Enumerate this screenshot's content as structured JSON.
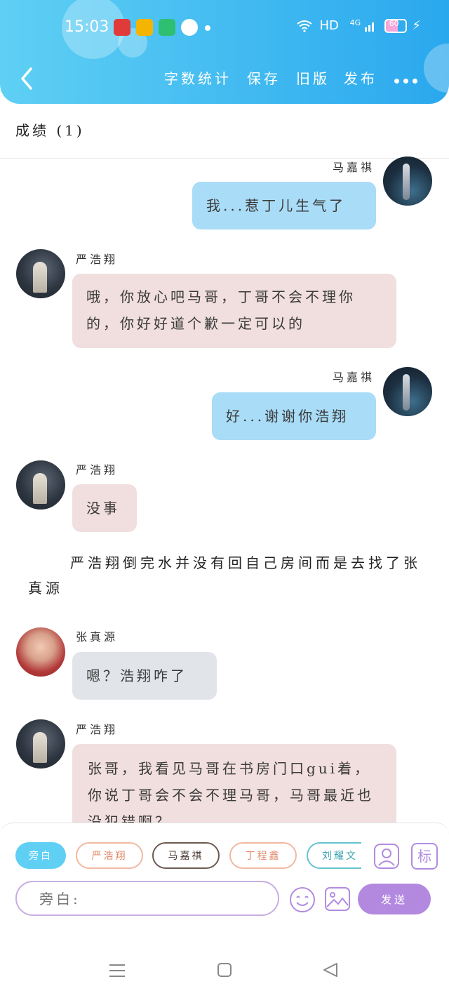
{
  "status_bar": {
    "time": "15:03",
    "network": "HD",
    "signal": "4G",
    "battery": "60"
  },
  "toolbar": {
    "items": [
      "字数统计",
      "保存",
      "旧版",
      "发布"
    ]
  },
  "chapter_title": "成绩 (1)",
  "messages": [
    {
      "speaker": "马嘉祺",
      "text": "我...惹丁儿生气了"
    },
    {
      "speaker": "严浩翔",
      "text": "哦，你放心吧马哥，丁哥不会不理你的，你好好道个歉一定可以的"
    },
    {
      "speaker": "马嘉祺",
      "text": "好...谢谢你浩翔"
    },
    {
      "speaker": "严浩翔",
      "text": "没事"
    },
    {
      "speaker": "张真源",
      "text": "嗯？浩翔咋了"
    },
    {
      "speaker": "严浩翔",
      "text": "张哥，我看见马哥在书房门口gui着，你说丁哥会不会不理马哥，马哥最近也没犯错啊？"
    }
  ],
  "narration": "严浩翔倒完水并没有回自己房间而是去找了张真源",
  "role_chips": [
    "旁白",
    "严浩翔",
    "马嘉祺",
    "丁程鑫",
    "刘耀文"
  ],
  "tag_label": "标",
  "input": {
    "placeholder": "旁白:"
  },
  "send_label": "发送",
  "colors": {
    "header": "#2aa8ee",
    "accent": "#b389e0",
    "bubble_self": "#a9dcf7",
    "bubble_other": "#f1dede"
  }
}
